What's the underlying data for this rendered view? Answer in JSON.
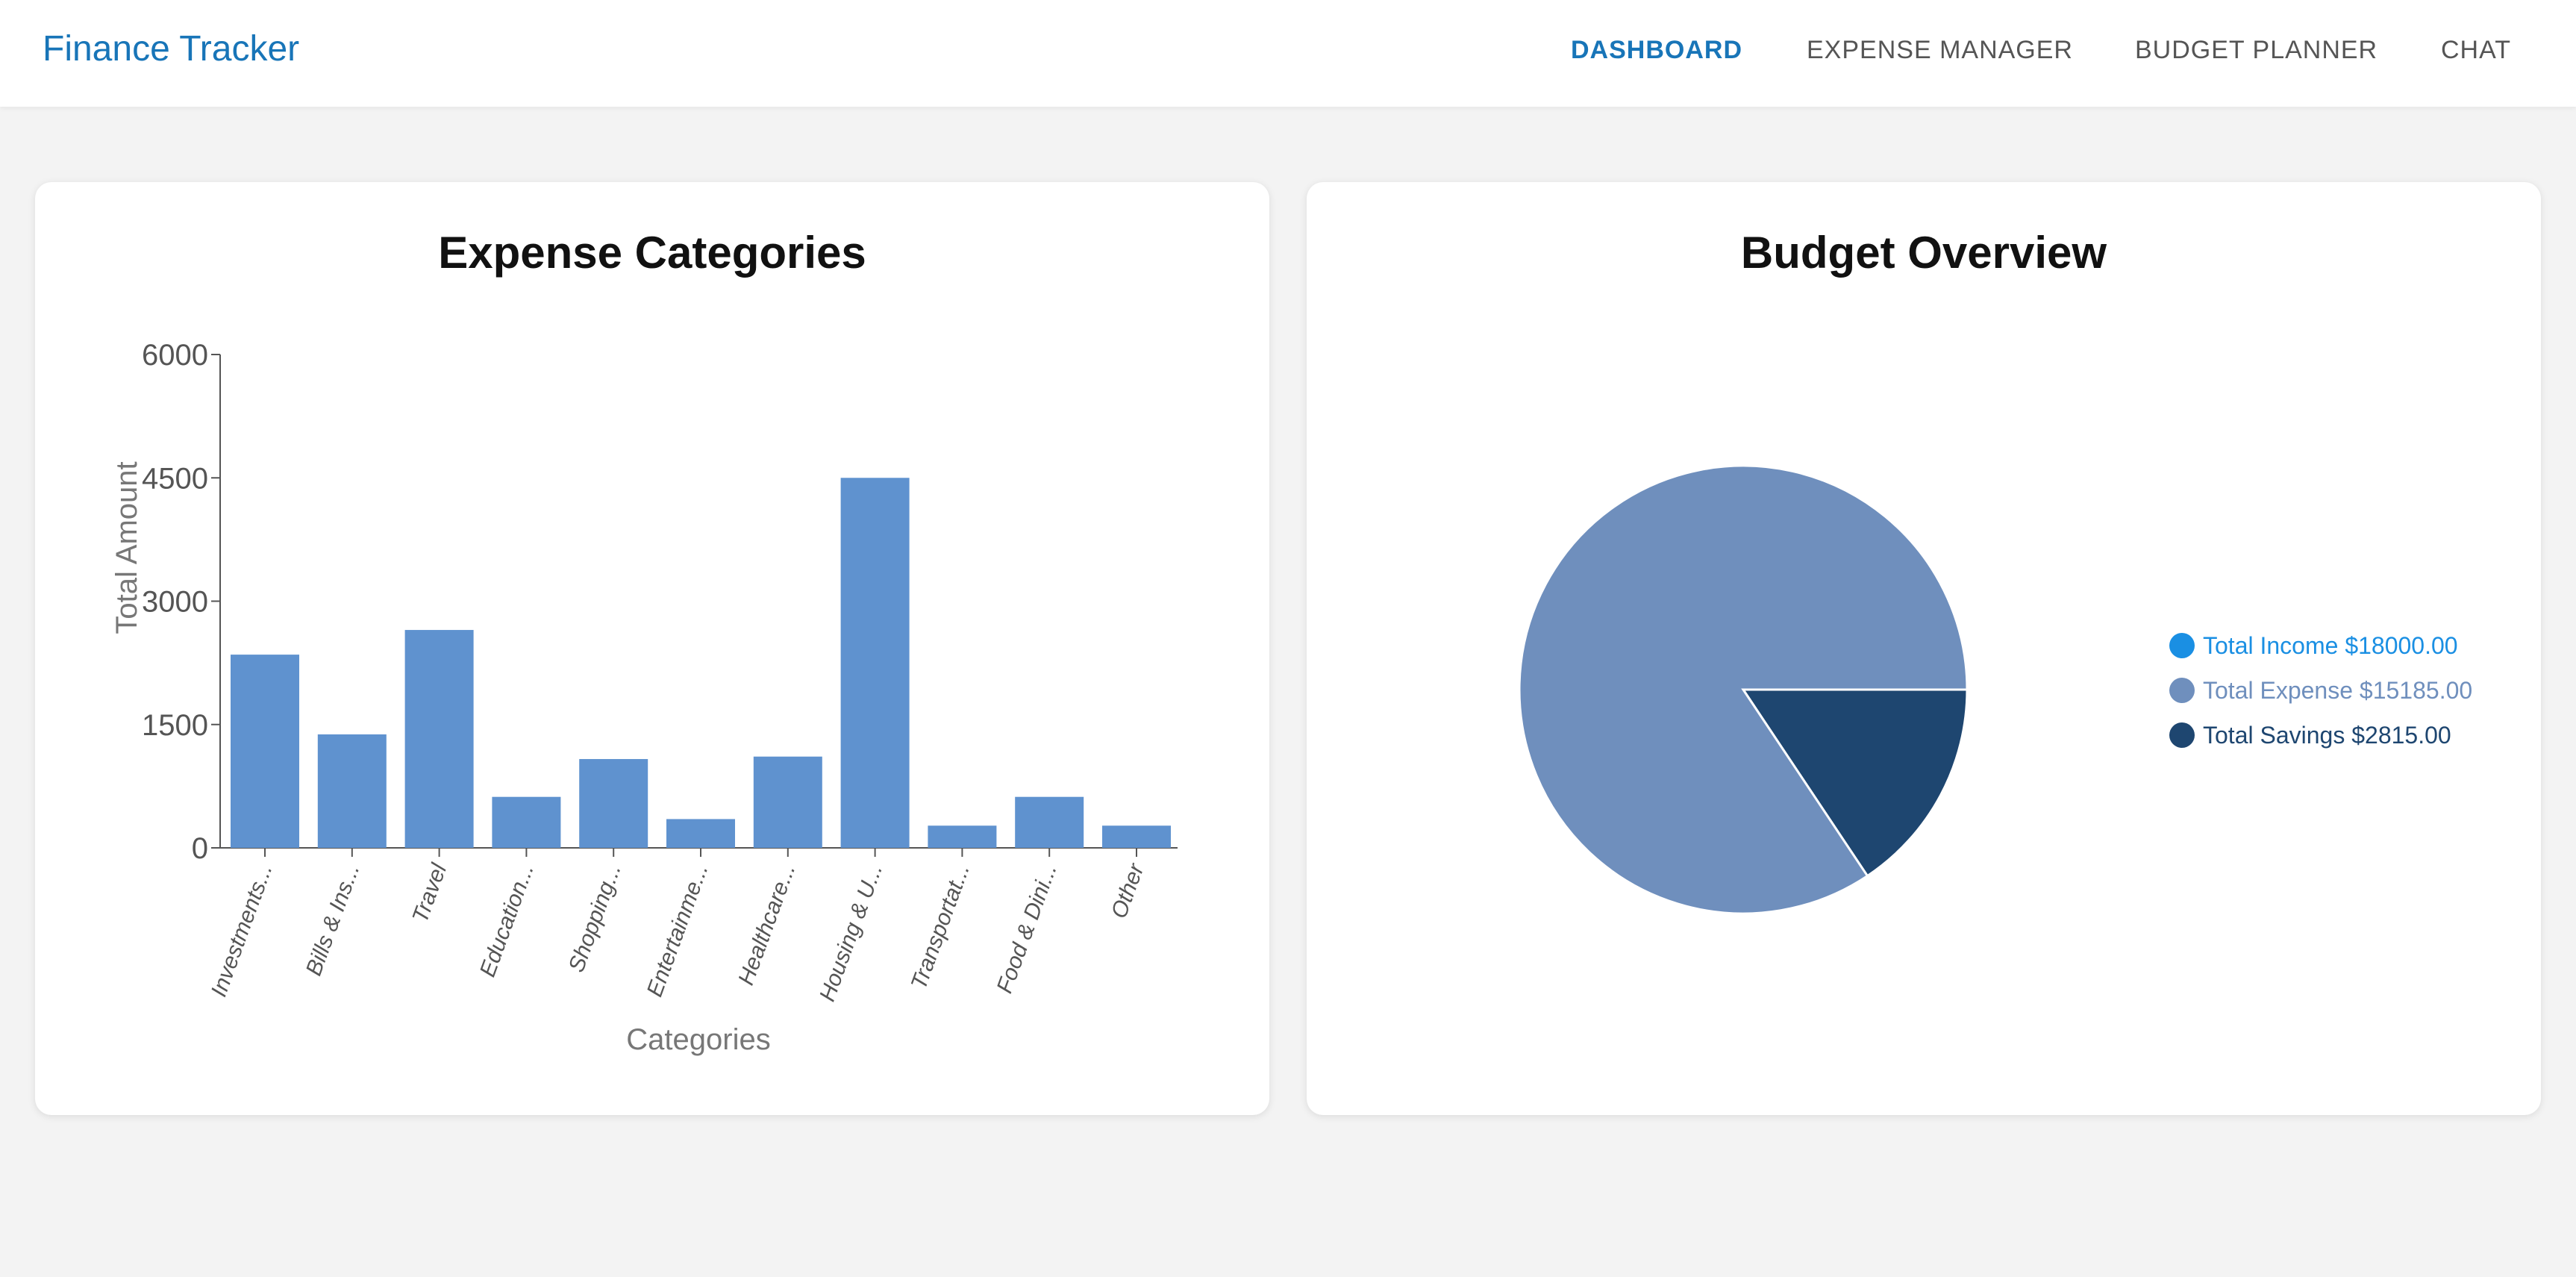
{
  "app": {
    "brand": "Finance Tracker"
  },
  "nav": {
    "items": [
      {
        "label": "DASHBOARD",
        "active": true
      },
      {
        "label": "EXPENSE MANAGER",
        "active": false
      },
      {
        "label": "BUDGET PLANNER",
        "active": false
      },
      {
        "label": "CHAT",
        "active": false
      }
    ]
  },
  "colors": {
    "brand": "#1875b8",
    "bar": "#5f92cf",
    "income": "#1a8fe3",
    "expense": "#6f8fbd",
    "savings": "#1e4670"
  },
  "expense_card": {
    "title": "Expense Categories"
  },
  "budget_card": {
    "title": "Budget Overview"
  },
  "chart_data": [
    {
      "type": "bar",
      "title": "Expense Categories",
      "xlabel": "Categories",
      "ylabel": "Total Amount",
      "ylim": [
        0,
        6000
      ],
      "yticks": [
        0,
        1500,
        3000,
        4500,
        6000
      ],
      "categories": [
        "Investments...",
        "Bills & Ins...",
        "Travel",
        "Education...",
        "Shopping...",
        "Entertainme...",
        "Healthcare...",
        "Housing & U...",
        "Transportat...",
        "Food & Dini...",
        "Other"
      ],
      "values": [
        2350,
        1380,
        2650,
        620,
        1080,
        350,
        1110,
        4500,
        270,
        620,
        270
      ],
      "grid": false
    },
    {
      "type": "pie",
      "title": "Budget Overview",
      "slices": [
        {
          "name": "Total Expense",
          "value": 15185,
          "color": "#6f8fbd"
        },
        {
          "name": "Total Savings",
          "value": 2815,
          "color": "#1e4670"
        }
      ],
      "legend": [
        {
          "label": "Total Income $18000.00",
          "color": "#1a8fe3"
        },
        {
          "label": "Total Expense $15185.00",
          "color": "#6f8fbd"
        },
        {
          "label": "Total Savings $2815.00",
          "color": "#1e4670"
        }
      ],
      "legend_position": "right"
    }
  ]
}
